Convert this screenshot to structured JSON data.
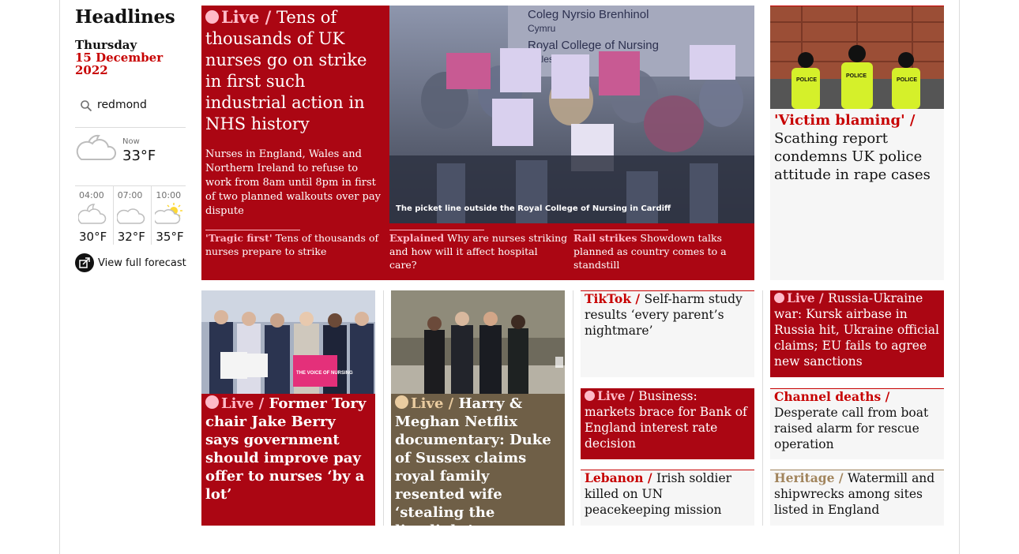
{
  "rail": {
    "title": "Headlines",
    "day": "Thursday",
    "date": "15 December 2022",
    "location": "redmond",
    "now_label": "Now",
    "now_temp": "33°F",
    "forecast": [
      {
        "time": "04:00",
        "temp": "30°F",
        "icon": "cloud-night-icon"
      },
      {
        "time": "07:00",
        "temp": "32°F",
        "icon": "cloud-icon"
      },
      {
        "time": "10:00",
        "temp": "35°F",
        "icon": "cloud-sun-icon"
      }
    ],
    "full_forecast": "View full forecast"
  },
  "main": {
    "kicker": "Live /",
    "headline": "Tens of thousands of UK nurses go on strike in first such industrial action in NHS history",
    "standfirst": "Nurses in England, Wales and Northern Ireland to refuse to work from 8am until 8pm in first of two planned walkouts over pay dispute",
    "caption": "The picket line outside the Royal College of Nursing in Cardiff",
    "sublinks": [
      {
        "kicker": "'Tragic first'",
        "text": "Tens of thousands of nurses prepare to strike"
      },
      {
        "kicker": "Explained",
        "text": "Why are nurses striking and how will it affect hospital care?"
      },
      {
        "kicker": "Rail strikes",
        "text": "Showdown talks planned as country comes to a standstill"
      }
    ]
  },
  "police": {
    "kicker": "'Victim blaming' /",
    "headline": "Scathing report condemns UK police attitude in rape cases"
  },
  "tory": {
    "kicker": "Live /",
    "headline": "Former Tory chair Jake Berry says government should improve pay offer to nurses ‘by a lot’"
  },
  "harry": {
    "kicker": "Live /",
    "headline": "Harry & Meghan Netflix documentary: Duke of Sussex claims royal family resented wife ‘stealing the limelight’"
  },
  "tiktok": {
    "kicker": "TikTok /",
    "headline": "Self-harm study results ‘every parent’s nightmare’"
  },
  "business": {
    "kicker": "Live /",
    "headline": "Business: markets brace for Bank of England interest rate decision"
  },
  "lebanon": {
    "kicker": "Lebanon /",
    "headline": "Irish soldier killed on UN peacekeeping mission"
  },
  "ukraine": {
    "kicker": "Live /",
    "headline": "Russia-Ukraine war: Kursk airbase in Russia hit, Ukraine official claims; EU fails to agree new sanctions"
  },
  "channel": {
    "kicker": "Channel deaths /",
    "headline": "Desperate call from boat raised alarm for rescue operation"
  },
  "heritage": {
    "kicker": "Heritage /",
    "headline": "Watermill and shipwrecks among sites listed in England"
  },
  "photo_signs": {
    "banner1": "Coleg Nyrsio Brenhinol",
    "banner2": "Cymru",
    "banner3": "Royal College of Nursing",
    "banner4": "Wales",
    "police_vest": "POLICE",
    "placard": "THE VOICE OF NURSING"
  },
  "colors": {
    "news_red": "#ab0613",
    "live_pink": "#ffbac8",
    "lifestyle": "#6f5f47",
    "sport_tan": "#a1845c"
  }
}
